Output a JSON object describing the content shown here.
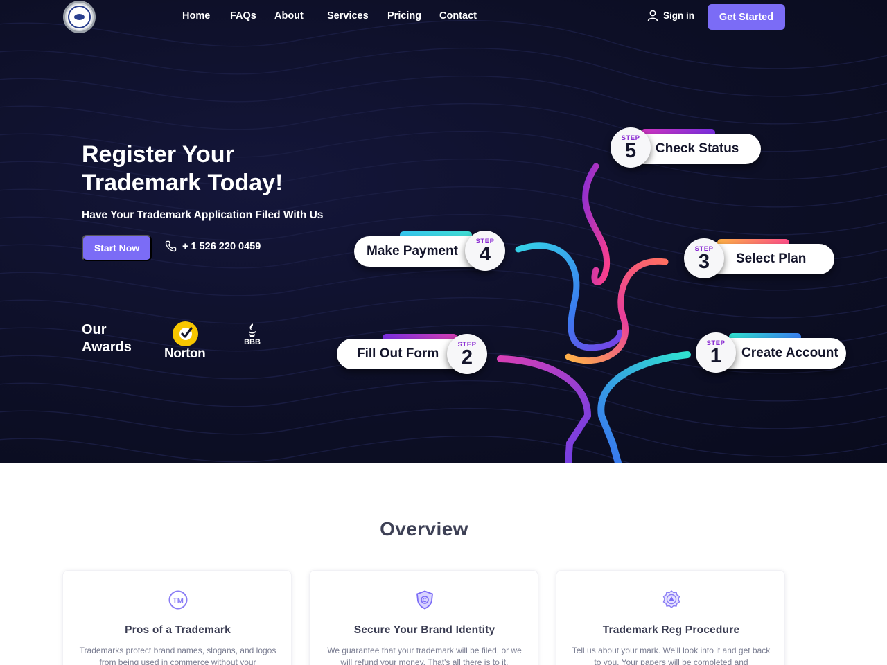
{
  "header": {
    "nav": [
      "Home",
      "FAQs",
      "About",
      "Services",
      "Pricing",
      "Contact"
    ],
    "sign_in": "Sign in",
    "cta": "Get Started"
  },
  "hero": {
    "title": "Register Your Trademark Today!",
    "subtitle": "Have Your Trademark Application Filed With Us",
    "start_button": "Start Now",
    "phone": "+ 1 526 220 0459"
  },
  "awards": {
    "title": "Our Awards",
    "norton": "Norton",
    "bbb": "BBB"
  },
  "steps": [
    {
      "step_label": "STEP",
      "number": "1",
      "label": "Create Account"
    },
    {
      "step_label": "STEP",
      "number": "2",
      "label": "Fill Out Form"
    },
    {
      "step_label": "STEP",
      "number": "3",
      "label": "Select Plan"
    },
    {
      "step_label": "STEP",
      "number": "4",
      "label": "Make Payment"
    },
    {
      "step_label": "STEP",
      "number": "5",
      "label": "Check Status"
    }
  ],
  "overview": {
    "title": "Overview",
    "cards": [
      {
        "icon": "trademark-icon",
        "title": "Pros of a Trademark",
        "text": "Trademarks protect brand names, slogans, and logos from being used in commerce without your"
      },
      {
        "icon": "shield-icon",
        "title": "Secure Your Brand Identity",
        "text": "We guarantee that your trademark will be filed, or we will refund your money. That's all there is to it."
      },
      {
        "icon": "badge-icon",
        "title": "Trademark Reg Procedure",
        "text": "Tell us about your mark. We'll look into it and get back to you. Your papers will be completed and"
      }
    ]
  },
  "colors": {
    "accent": "#7b6cf6",
    "hero_bg": "#0d0f26",
    "step_label": "#8a2bd2"
  }
}
